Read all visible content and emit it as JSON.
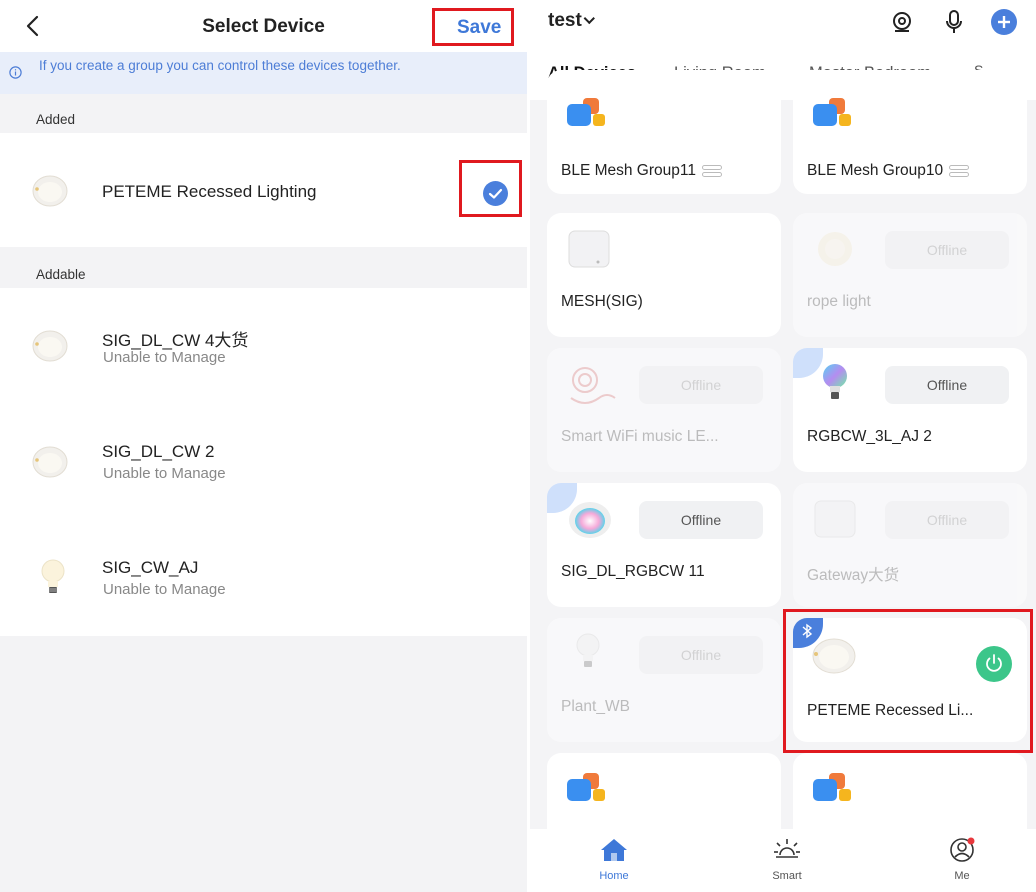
{
  "left": {
    "title": "Select Device",
    "save_label": "Save",
    "info_text": "If you create a group you can control these devices together.",
    "added_label": "Added",
    "addable_label": "Addable",
    "added_device": {
      "name": "PETEME Recessed Lighting",
      "icon": "recessed-light-icon",
      "checked": true
    },
    "addable_devices": [
      {
        "name": "SIG_DL_CW 4大货",
        "status": "Unable to Manage",
        "icon": "recessed-light-icon"
      },
      {
        "name": "SIG_DL_CW 2",
        "status": "Unable to Manage",
        "icon": "recessed-light-icon"
      },
      {
        "name": "SIG_CW_AJ",
        "status": "Unable to Manage",
        "icon": "bulb-icon"
      }
    ]
  },
  "right": {
    "home_name": "test",
    "tabs": [
      "All Devices",
      "Living Room",
      "Master Bedroom",
      "S"
    ],
    "active_tab": "All Devices",
    "offline_label": "Offline",
    "cards": [
      {
        "name": "BLE Mesh Group11",
        "icon": "group-icon"
      },
      {
        "name": "BLE Mesh Group10",
        "icon": "group-icon"
      },
      {
        "name": "MESH(SIG)",
        "icon": "gateway-icon"
      },
      {
        "name": "rope light",
        "icon": "light-icon",
        "offline": true
      },
      {
        "name": "Smart WiFi music LE...",
        "icon": "light-strip-icon",
        "offline": true
      },
      {
        "name": "RGBCW_3L_AJ 2",
        "icon": "color-bulb-icon",
        "offline": true,
        "bluetooth": true
      },
      {
        "name": "SIG_DL_RGBCW 11",
        "icon": "color-downlight-icon",
        "offline": true,
        "bluetooth": true
      },
      {
        "name": "Gateway大货",
        "icon": "gateway-icon",
        "offline": true
      },
      {
        "name": "Plant_WB",
        "icon": "bulb-icon",
        "offline": true
      },
      {
        "name": "PETEME Recessed Li...",
        "icon": "recessed-light-icon",
        "power": true,
        "bluetooth": true
      },
      {
        "name": "",
        "icon": "group-icon"
      },
      {
        "name": "",
        "icon": "group-icon"
      }
    ],
    "nav": [
      {
        "label": "Home",
        "icon": "home-icon",
        "active": true
      },
      {
        "label": "Smart",
        "icon": "sun-icon"
      },
      {
        "label": "Me",
        "icon": "profile-icon"
      }
    ],
    "colors": {
      "accent": "#3e78d8",
      "power_on": "#3cc68a",
      "highlight": "#e0191f"
    }
  }
}
